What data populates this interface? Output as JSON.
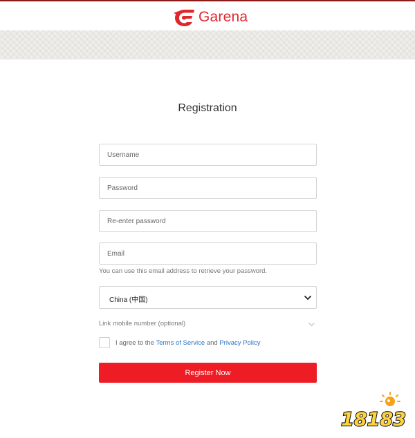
{
  "header": {
    "brand_name": "Garena"
  },
  "form": {
    "title": "Registration",
    "username_placeholder": "Username",
    "password_placeholder": "Password",
    "reenter_placeholder": "Re-enter password",
    "email_placeholder": "Email",
    "email_hint": "You can use this email address to retrieve your password.",
    "country_selected": "China (中国)",
    "link_mobile_label": "Link mobile number (optional)",
    "agree_prefix": "I agree to the ",
    "terms_link": "Terms of Service",
    "agree_and": " and ",
    "privacy_link": "Privacy Policy",
    "register_label": "Register Now"
  },
  "watermark": {
    "text": "18183"
  },
  "colors": {
    "brand_red": "#e0262d",
    "button_red": "#ee1c25",
    "link_blue": "#2a73c4"
  },
  "icons": {
    "logo": "garena-logo-icon",
    "select": "chevron-down-icon",
    "link_mobile": "chevron-down-icon"
  }
}
